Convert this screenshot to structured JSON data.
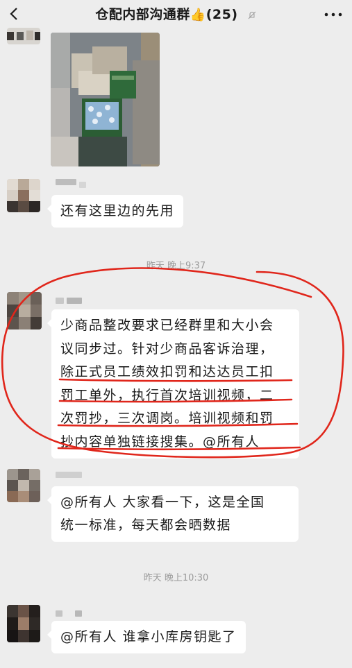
{
  "header": {
    "title": "仓配内部沟通群",
    "thumb_emoji": "👍",
    "member_count": "(25)"
  },
  "messages": [
    {
      "type": "image"
    },
    {
      "type": "text",
      "text": "还有这里边的先用"
    },
    {
      "type": "time",
      "text": "昨天 晚上9:37"
    },
    {
      "type": "text",
      "lines": [
        "少商品整改要求已经群里和大小会",
        "议同步过。针对少商品客诉治理，",
        "除正式员工绩效扣罚和达达员工扣",
        "罚工单外，执行首次培训视频，二",
        "次罚抄，三次调岗。培训视频和罚",
        "抄内容单独链接搜集。@所有人"
      ]
    },
    {
      "type": "text",
      "lines": [
        "@所有人  大家看一下，这是全国",
        "统一标准，每天都会晒数据"
      ]
    },
    {
      "type": "time",
      "text": "昨天 晚上10:30"
    },
    {
      "type": "text",
      "text": "@所有人  谁拿小库房钥匙了"
    }
  ],
  "colors": {
    "background": "#ededed",
    "bubble": "#ffffff",
    "annotation_red": "#e0261b",
    "time_text": "#9a9a9a"
  }
}
